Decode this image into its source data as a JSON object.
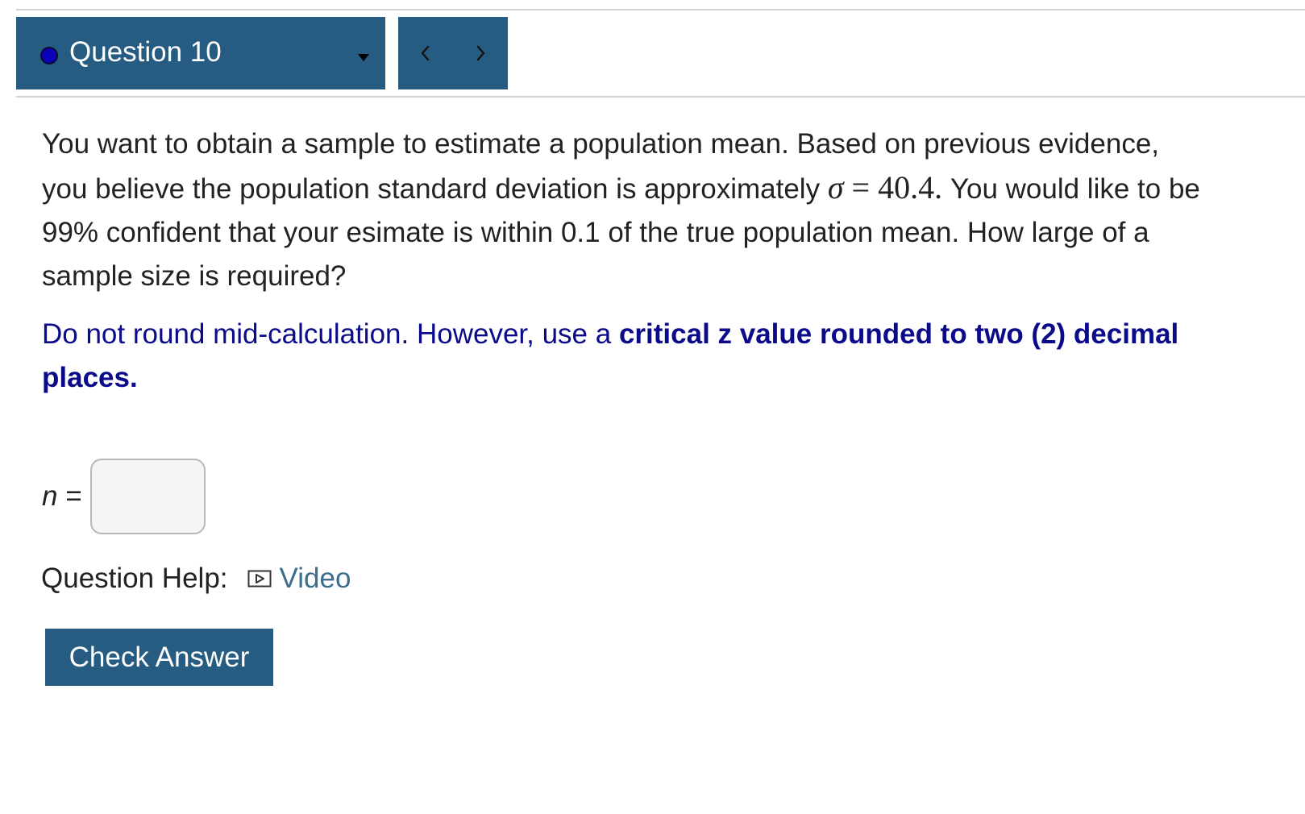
{
  "question_nav": {
    "selected_question": "Question 10",
    "status_color": "#0a00b8",
    "prev_icon": "chevron-left-icon",
    "next_icon": "chevron-right-icon"
  },
  "question": {
    "prompt_line_1": "You want to obtain a sample to estimate a population mean. Based on previous evidence, you believe the population standard deviation is approximately",
    "sigma_symbol": "σ",
    "equals": "=",
    "sigma_value": "40.4.",
    "prompt_line_2": "You would like to be 99% confident that your esimate is within 0.1 of the true population mean. How large of a sample size is required?",
    "instruction_plain": "Do not round mid-calculation. However, use a",
    "instruction_bold": "critical z value rounded to two (2) decimal places."
  },
  "answer": {
    "variable": "n",
    "equals": "=",
    "value": "",
    "placeholder": ""
  },
  "help": {
    "label": "Question Help:",
    "video_label": "Video",
    "video_icon": "play-video-icon"
  },
  "actions": {
    "check_answer_label": "Check Answer"
  },
  "colors": {
    "nav_background": "#265b82",
    "instruction_text": "#0a0a8a",
    "link_text": "#3b6d8f"
  }
}
